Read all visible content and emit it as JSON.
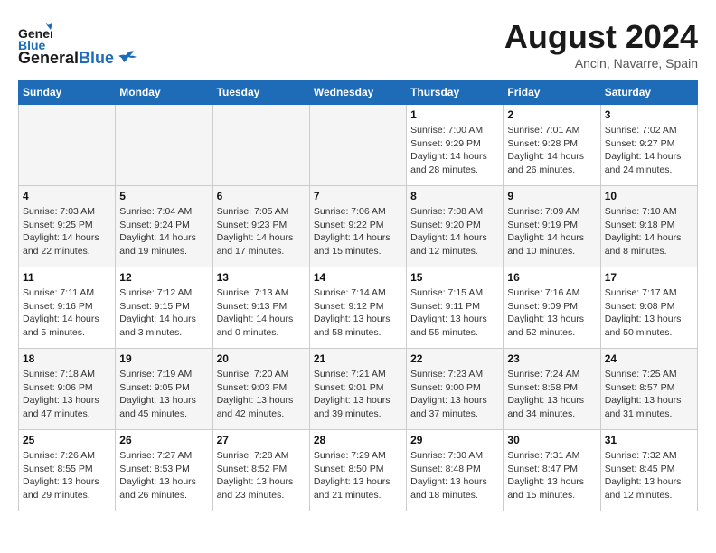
{
  "header": {
    "logo_general": "General",
    "logo_blue": "Blue",
    "month_year": "August 2024",
    "location": "Ancin, Navarre, Spain"
  },
  "days_of_week": [
    "Sunday",
    "Monday",
    "Tuesday",
    "Wednesday",
    "Thursday",
    "Friday",
    "Saturday"
  ],
  "weeks": [
    [
      {
        "day": "",
        "sunrise": "",
        "sunset": "",
        "daylight": ""
      },
      {
        "day": "",
        "sunrise": "",
        "sunset": "",
        "daylight": ""
      },
      {
        "day": "",
        "sunrise": "",
        "sunset": "",
        "daylight": ""
      },
      {
        "day": "",
        "sunrise": "",
        "sunset": "",
        "daylight": ""
      },
      {
        "day": "1",
        "sunrise": "7:00 AM",
        "sunset": "9:29 PM",
        "daylight": "14 hours and 28 minutes."
      },
      {
        "day": "2",
        "sunrise": "7:01 AM",
        "sunset": "9:28 PM",
        "daylight": "14 hours and 26 minutes."
      },
      {
        "day": "3",
        "sunrise": "7:02 AM",
        "sunset": "9:27 PM",
        "daylight": "14 hours and 24 minutes."
      }
    ],
    [
      {
        "day": "4",
        "sunrise": "7:03 AM",
        "sunset": "9:25 PM",
        "daylight": "14 hours and 22 minutes."
      },
      {
        "day": "5",
        "sunrise": "7:04 AM",
        "sunset": "9:24 PM",
        "daylight": "14 hours and 19 minutes."
      },
      {
        "day": "6",
        "sunrise": "7:05 AM",
        "sunset": "9:23 PM",
        "daylight": "14 hours and 17 minutes."
      },
      {
        "day": "7",
        "sunrise": "7:06 AM",
        "sunset": "9:22 PM",
        "daylight": "14 hours and 15 minutes."
      },
      {
        "day": "8",
        "sunrise": "7:08 AM",
        "sunset": "9:20 PM",
        "daylight": "14 hours and 12 minutes."
      },
      {
        "day": "9",
        "sunrise": "7:09 AM",
        "sunset": "9:19 PM",
        "daylight": "14 hours and 10 minutes."
      },
      {
        "day": "10",
        "sunrise": "7:10 AM",
        "sunset": "9:18 PM",
        "daylight": "14 hours and 8 minutes."
      }
    ],
    [
      {
        "day": "11",
        "sunrise": "7:11 AM",
        "sunset": "9:16 PM",
        "daylight": "14 hours and 5 minutes."
      },
      {
        "day": "12",
        "sunrise": "7:12 AM",
        "sunset": "9:15 PM",
        "daylight": "14 hours and 3 minutes."
      },
      {
        "day": "13",
        "sunrise": "7:13 AM",
        "sunset": "9:13 PM",
        "daylight": "14 hours and 0 minutes."
      },
      {
        "day": "14",
        "sunrise": "7:14 AM",
        "sunset": "9:12 PM",
        "daylight": "13 hours and 58 minutes."
      },
      {
        "day": "15",
        "sunrise": "7:15 AM",
        "sunset": "9:11 PM",
        "daylight": "13 hours and 55 minutes."
      },
      {
        "day": "16",
        "sunrise": "7:16 AM",
        "sunset": "9:09 PM",
        "daylight": "13 hours and 52 minutes."
      },
      {
        "day": "17",
        "sunrise": "7:17 AM",
        "sunset": "9:08 PM",
        "daylight": "13 hours and 50 minutes."
      }
    ],
    [
      {
        "day": "18",
        "sunrise": "7:18 AM",
        "sunset": "9:06 PM",
        "daylight": "13 hours and 47 minutes."
      },
      {
        "day": "19",
        "sunrise": "7:19 AM",
        "sunset": "9:05 PM",
        "daylight": "13 hours and 45 minutes."
      },
      {
        "day": "20",
        "sunrise": "7:20 AM",
        "sunset": "9:03 PM",
        "daylight": "13 hours and 42 minutes."
      },
      {
        "day": "21",
        "sunrise": "7:21 AM",
        "sunset": "9:01 PM",
        "daylight": "13 hours and 39 minutes."
      },
      {
        "day": "22",
        "sunrise": "7:23 AM",
        "sunset": "9:00 PM",
        "daylight": "13 hours and 37 minutes."
      },
      {
        "day": "23",
        "sunrise": "7:24 AM",
        "sunset": "8:58 PM",
        "daylight": "13 hours and 34 minutes."
      },
      {
        "day": "24",
        "sunrise": "7:25 AM",
        "sunset": "8:57 PM",
        "daylight": "13 hours and 31 minutes."
      }
    ],
    [
      {
        "day": "25",
        "sunrise": "7:26 AM",
        "sunset": "8:55 PM",
        "daylight": "13 hours and 29 minutes."
      },
      {
        "day": "26",
        "sunrise": "7:27 AM",
        "sunset": "8:53 PM",
        "daylight": "13 hours and 26 minutes."
      },
      {
        "day": "27",
        "sunrise": "7:28 AM",
        "sunset": "8:52 PM",
        "daylight": "13 hours and 23 minutes."
      },
      {
        "day": "28",
        "sunrise": "7:29 AM",
        "sunset": "8:50 PM",
        "daylight": "13 hours and 21 minutes."
      },
      {
        "day": "29",
        "sunrise": "7:30 AM",
        "sunset": "8:48 PM",
        "daylight": "13 hours and 18 minutes."
      },
      {
        "day": "30",
        "sunrise": "7:31 AM",
        "sunset": "8:47 PM",
        "daylight": "13 hours and 15 minutes."
      },
      {
        "day": "31",
        "sunrise": "7:32 AM",
        "sunset": "8:45 PM",
        "daylight": "13 hours and 12 minutes."
      }
    ]
  ]
}
